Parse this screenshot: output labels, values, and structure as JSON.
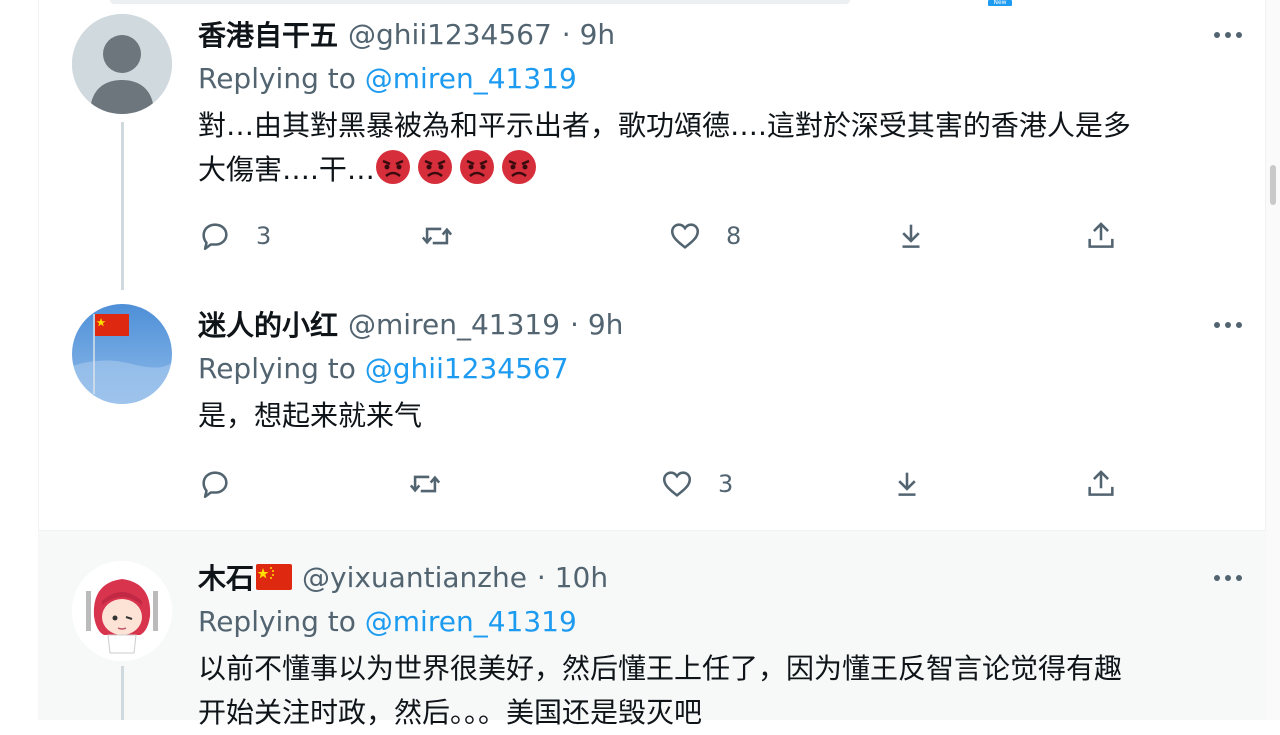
{
  "top": {
    "new_badge": "New"
  },
  "tweets": [
    {
      "name": "香港自干五",
      "handle": "@ghii1234567",
      "time": "· 9h",
      "replying_label": "Replying to",
      "replying_to": "@miren_41319",
      "text_line1": "對…由其對黑暴被為和平示出者，歌功頌德….這對於深受其害的香港人是多",
      "text_line2": "大傷害….干…",
      "reply_count": "3",
      "retweet_count": "",
      "like_count": "8"
    },
    {
      "name": "迷人的小红",
      "handle": "@miren_41319",
      "time": "· 9h",
      "replying_label": "Replying to",
      "replying_to": "@ghii1234567",
      "text_line1": "是，想起来就来气",
      "reply_count": "",
      "retweet_count": "",
      "like_count": "3"
    },
    {
      "name": "木石",
      "handle": "@yixuantianzhe",
      "time": "· 10h",
      "replying_label": "Replying to",
      "replying_to": "@miren_41319",
      "text_line1": "以前不懂事以为世界很美好，然后懂王上任了，因为懂王反智言论觉得有趣",
      "text_line2": "开始关注时政，然后。。。美国还是毁灭吧"
    }
  ],
  "colors": {
    "accent": "#1d9bf0",
    "muted": "#536471",
    "text": "#0f1419"
  }
}
